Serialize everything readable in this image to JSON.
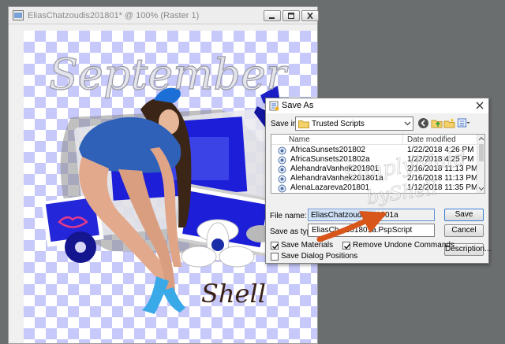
{
  "image_window": {
    "title": "EliasChatzoudis201801* @ 100% (Raster 1)"
  },
  "canvas": {
    "title_text": "September",
    "signature_text": "Shell"
  },
  "dialog": {
    "title": "Save As",
    "save_in_label": "Save in:",
    "save_in_value": "Trusted Scripts",
    "columns": {
      "name": "Name",
      "date": "Date modified"
    },
    "files": [
      {
        "name": "AfricaSunsets201802",
        "date": "1/22/2018 4:26 PM"
      },
      {
        "name": "AfricaSunsets201802a",
        "date": "1/22/2018 4:25 PM"
      },
      {
        "name": "AlehandraVanhek201801",
        "date": "2/16/2018 11:13 PM"
      },
      {
        "name": "AlehandraVanhek201801a",
        "date": "2/16/2018 11:13 PM"
      },
      {
        "name": "AlenaLazareva201801",
        "date": "1/12/2018 11:35 PM"
      }
    ],
    "file_name_label": "File name:",
    "file_name_value": "EliasChatzoudis201801a",
    "save_type_label": "Save as type:",
    "save_type_value": "EliasCh...201801a.PspScript",
    "buttons": {
      "save": "Save",
      "cancel": "Cancel",
      "description": "Description..."
    },
    "checkboxes": {
      "save_materials": {
        "label": "Save Materials",
        "checked": true
      },
      "remove_undone": {
        "label": "Remove Undone Commands",
        "checked": true
      },
      "save_dialog_positions": {
        "label": "Save Dialog Positions",
        "checked": false
      }
    }
  },
  "watermark": {
    "line1": "SimplyMaid",
    "line2": "byShell"
  },
  "colors": {
    "accent_blue": "#1d1fd8",
    "checker_blue": "#c7c9fb",
    "arrow_orange": "#d9561b"
  }
}
